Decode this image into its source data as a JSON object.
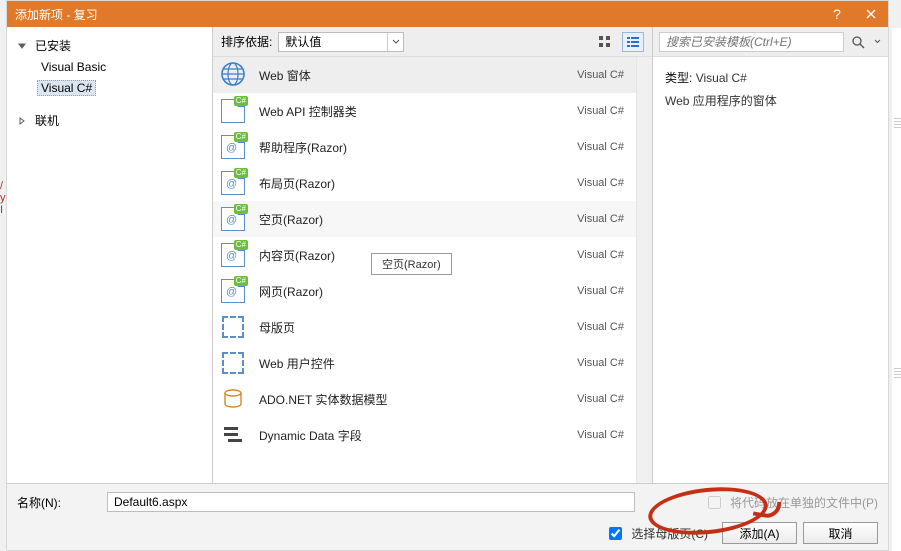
{
  "title": "添加新项 - 复习",
  "left": {
    "installed": "已安装",
    "items": [
      "Visual Basic",
      "Visual C#"
    ],
    "selected_index": 1,
    "online": "联机"
  },
  "sort": {
    "label": "排序依据:",
    "value": "默认值"
  },
  "templates": [
    {
      "name": "Web 窗体",
      "lang": "Visual C#",
      "icon": "globe"
    },
    {
      "name": "Web API 控制器类",
      "lang": "Visual C#",
      "icon": "csdoc"
    },
    {
      "name": "帮助程序(Razor)",
      "lang": "Visual C#",
      "icon": "csdoc-at"
    },
    {
      "name": "布局页(Razor)",
      "lang": "Visual C#",
      "icon": "csdoc-at"
    },
    {
      "name": "空页(Razor)",
      "lang": "Visual C#",
      "icon": "csdoc-at"
    },
    {
      "name": "内容页(Razor)",
      "lang": "Visual C#",
      "icon": "csdoc-at"
    },
    {
      "name": "网页(Razor)",
      "lang": "Visual C#",
      "icon": "csdoc-at"
    },
    {
      "name": "母版页",
      "lang": "Visual C#",
      "icon": "dash"
    },
    {
      "name": "Web 用户控件",
      "lang": "Visual C#",
      "icon": "dash"
    },
    {
      "name": "ADO.NET 实体数据模型",
      "lang": "Visual C#",
      "icon": "db"
    },
    {
      "name": "Dynamic Data 字段",
      "lang": "Visual C#",
      "icon": "fields"
    }
  ],
  "template_tooltip": "空页(Razor)",
  "highlight_index": 0,
  "selected_index": 4,
  "search": {
    "placeholder": "搜索已安装模板(Ctrl+E)"
  },
  "detail": {
    "type_label": "类型:",
    "type_value": "Visual C#",
    "desc": "Web 应用程序的窗体"
  },
  "footer": {
    "name_label": "名称(N):",
    "name_value": "Default6.aspx",
    "chk1": "将代码放在单独的文件中(P)",
    "chk2": "选择母版页(C)",
    "add": "添加(A)",
    "cancel": "取消"
  }
}
